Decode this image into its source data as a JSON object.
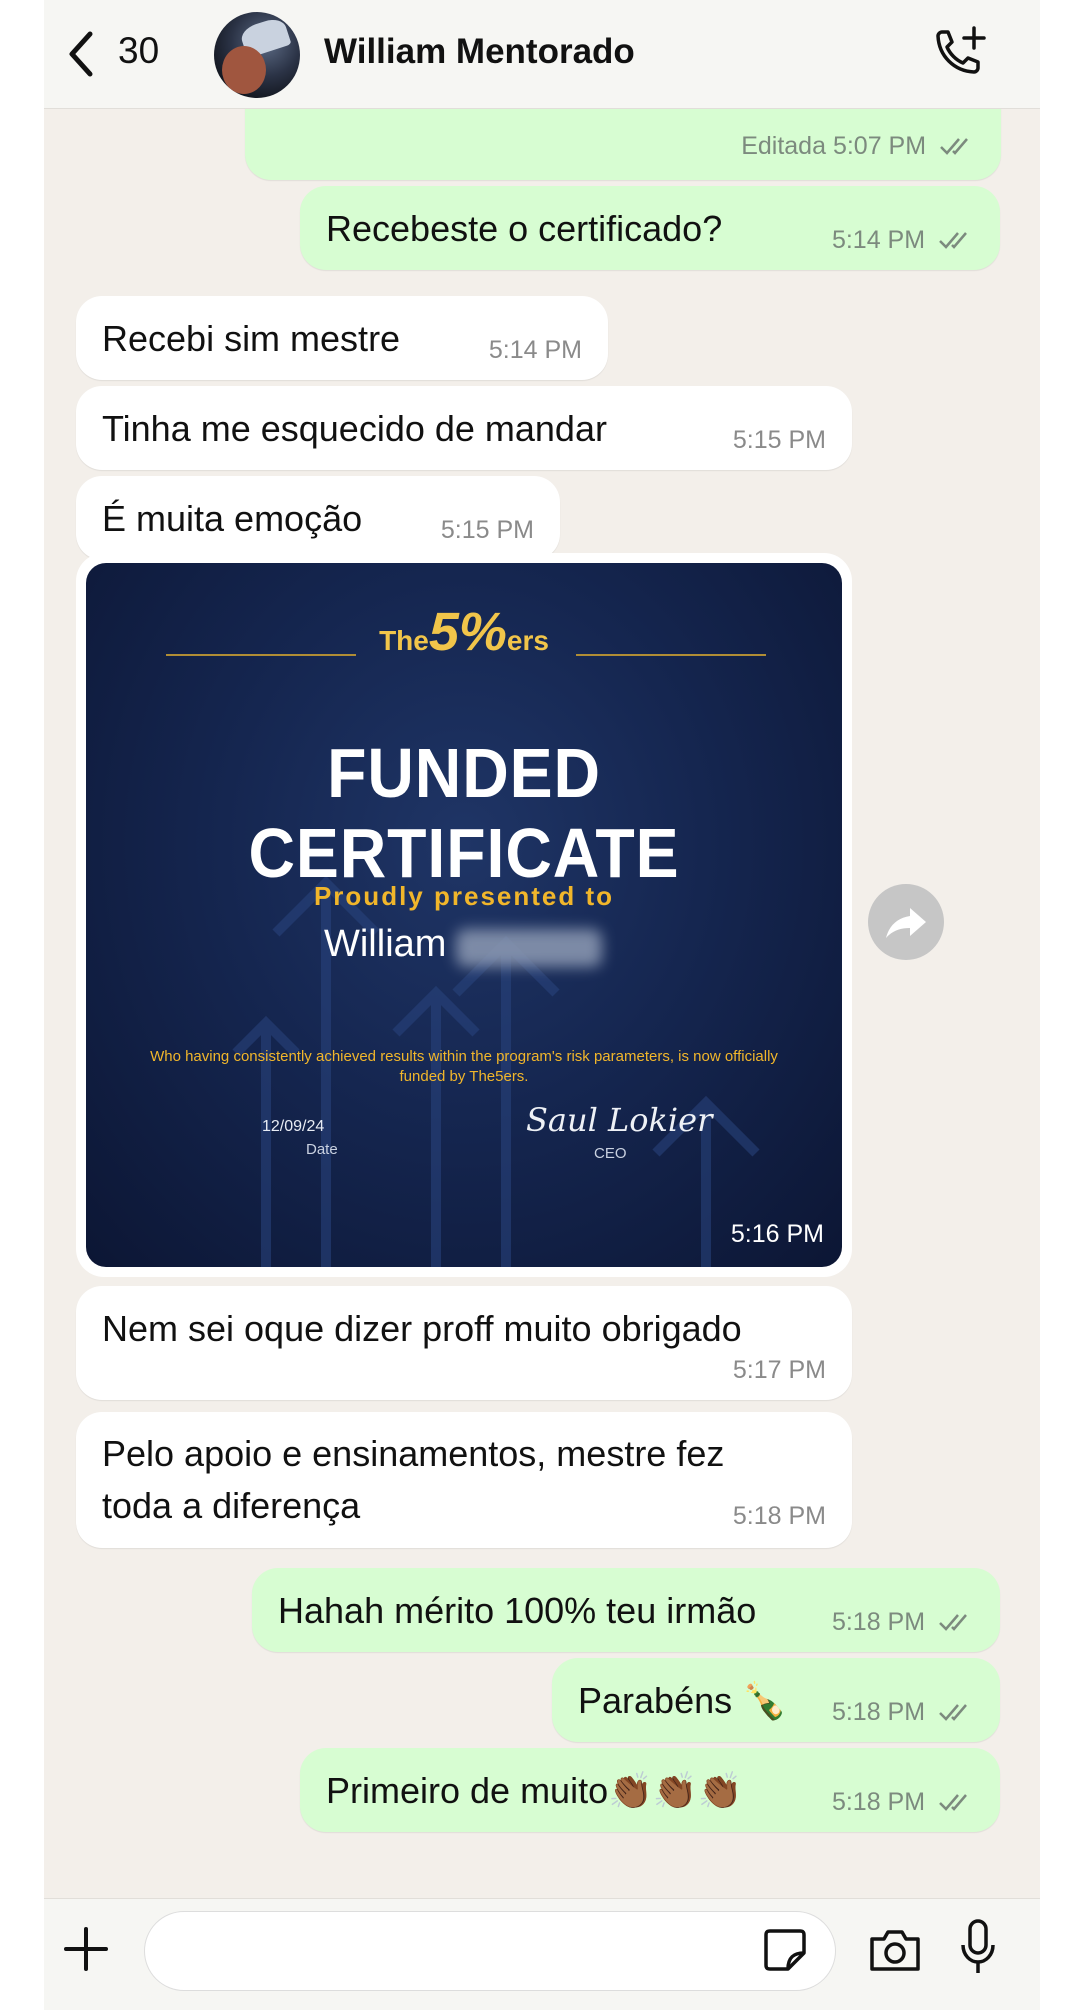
{
  "header": {
    "back_count": "30",
    "contact_name": "William Mentorado"
  },
  "messages": [
    {
      "direction": "out",
      "text": "",
      "edited_label": "Editada",
      "time": "5:07 PM",
      "read": true
    },
    {
      "direction": "out",
      "text": "Recebeste o certificado?",
      "time": "5:14 PM",
      "read": true
    },
    {
      "direction": "in",
      "text": "Recebi sim mestre",
      "time": "5:14 PM"
    },
    {
      "direction": "in",
      "text": "Tinha me esquecido de mandar",
      "time": "5:15 PM"
    },
    {
      "direction": "in",
      "text": "É muita emoção",
      "time": "5:15 PM"
    },
    {
      "direction": "in",
      "type": "image",
      "time": "5:16 PM"
    },
    {
      "direction": "in",
      "text": "Nem sei oque dizer proff muito obrigado",
      "time": "5:17 PM"
    },
    {
      "direction": "in",
      "text": "Pelo apoio e ensinamentos, mestre fez toda a diferença",
      "time": "5:18 PM"
    },
    {
      "direction": "out",
      "text": "Hahah mérito 100% teu irmão",
      "time": "5:18 PM",
      "read": true
    },
    {
      "direction": "out",
      "text": "Parabéns 🍾",
      "time": "5:18 PM",
      "read": true
    },
    {
      "direction": "out",
      "text": "Primeiro de muito👏🏾👏🏾👏🏾",
      "time": "5:18 PM",
      "read": true
    }
  ],
  "certificate": {
    "brand_prefix": "The",
    "brand_number": "5%",
    "brand_suffix": "ers",
    "title": "FUNDED CERTIFICATE",
    "presented": "Proudly presented to",
    "recipient": "William",
    "body": "Who having consistently achieved results within the program's risk parameters, is now officially funded by The5ers.",
    "date": "12/09/24",
    "date_label": "Date",
    "signature": "Saul Lokier",
    "signer_title": "CEO"
  },
  "input": {
    "placeholder": ""
  },
  "colors": {
    "outgoing_bubble": "#d7fdd2",
    "incoming_bubble": "#ffffff",
    "chat_background": "#f3efea",
    "read_ticks": "#53bdeb"
  }
}
